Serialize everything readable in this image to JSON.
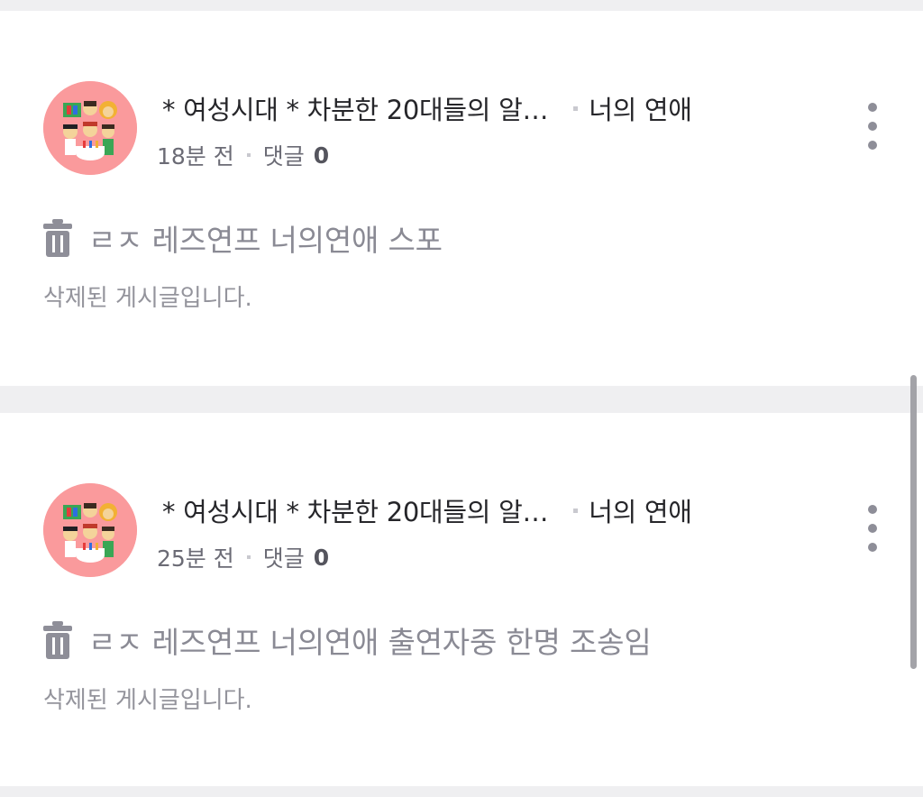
{
  "posts": [
    {
      "club_name": "* 여성시대 *  차분한 20대들의 알…",
      "board_name": "너의 연애",
      "time": "18분 전",
      "comment_label": "댓글",
      "comment_count": "0",
      "title": "ㄹㅈ 레즈연프 너의연애 스포",
      "deleted_note": "삭제된 게시글입니다."
    },
    {
      "club_name": "* 여성시대 *  차분한 20대들의 알…",
      "board_name": "너의 연애",
      "time": "25분 전",
      "comment_label": "댓글",
      "comment_count": "0",
      "title": "ㄹㅈ 레즈연프 너의연애 출연자중 한명 조송임",
      "deleted_note": "삭제된 게시글입니다."
    }
  ],
  "icons": {
    "more": "more-vertical-icon",
    "trash": "trash-icon",
    "avatar": "club-avatar"
  },
  "colors": {
    "background": "#efeff1",
    "card": "#ffffff",
    "avatar_bg": "#fa9a9c",
    "muted_text": "#8a8a94"
  }
}
